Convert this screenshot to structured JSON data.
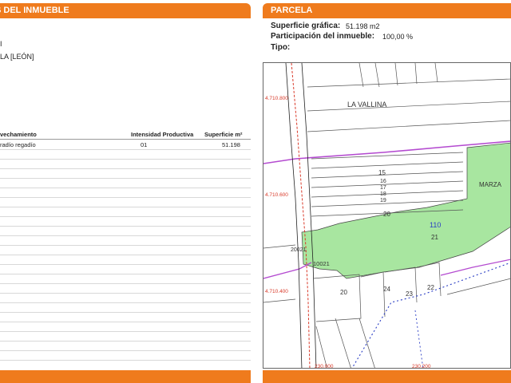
{
  "left_panel": {
    "title": "S DEL INMUEBLE",
    "lines": [
      "I",
      "LA [LEÓN]"
    ],
    "table": {
      "headers": [
        "vechamiento",
        "Intensidad Productiva",
        "Superficie m²"
      ],
      "rows": [
        {
          "aprovechamiento": "radío regadío",
          "intensidad": "01",
          "superficie": "51.198"
        }
      ]
    }
  },
  "right_panel": {
    "title": "PARCELA",
    "superficie_label": "Superficie gráfica:",
    "superficie_value": "51.198 m2",
    "participacion_label": "Participación del inmueble:",
    "participacion_value": "100,00 %",
    "tipo_label": "Tipo:",
    "tipo_value": ""
  },
  "map": {
    "place_labels": [
      "LA VALLINA",
      "MARZA"
    ],
    "parcel_numbers": [
      "15",
      "16",
      "17",
      "18",
      "19",
      "20",
      "21",
      "110",
      "10021",
      "20021",
      "20",
      "24",
      "23",
      "22"
    ],
    "coord_labels": [
      "4.710.800",
      "4.710.600",
      "4.710.400",
      "230.000",
      "230.200"
    ],
    "colors": {
      "parcel_fill": "#a8e6a0",
      "boundary": "#b44bd0",
      "road": "#d93a2a",
      "accent": "#ef7b1d"
    }
  }
}
